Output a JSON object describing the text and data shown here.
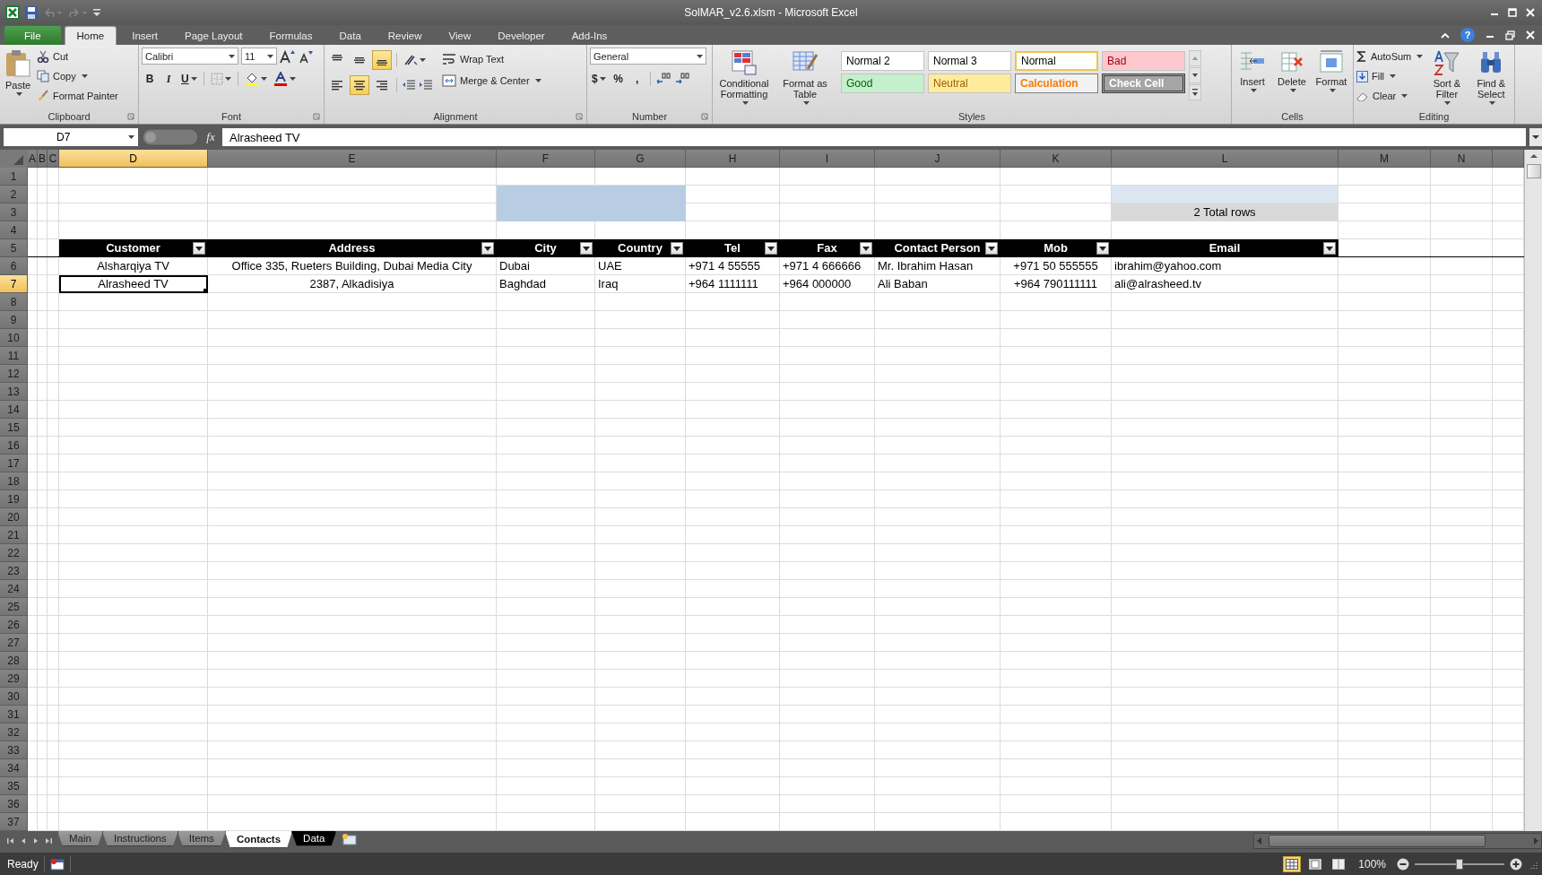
{
  "window": {
    "title": "SolMAR_v2.6.xlsm - Microsoft Excel",
    "help": "?"
  },
  "ribbon_tabs": [
    {
      "label": "File",
      "kind": "file",
      "selected": false
    },
    {
      "label": "Home",
      "kind": "tab",
      "selected": true
    },
    {
      "label": "Insert",
      "kind": "tab",
      "selected": false
    },
    {
      "label": "Page Layout",
      "kind": "tab",
      "selected": false
    },
    {
      "label": "Formulas",
      "kind": "tab",
      "selected": false
    },
    {
      "label": "Data",
      "kind": "tab",
      "selected": false
    },
    {
      "label": "Review",
      "kind": "tab",
      "selected": false
    },
    {
      "label": "View",
      "kind": "tab",
      "selected": false
    },
    {
      "label": "Developer",
      "kind": "tab",
      "selected": false
    },
    {
      "label": "Add-Ins",
      "kind": "tab",
      "selected": false
    }
  ],
  "clipboard": {
    "label": "Clipboard",
    "paste": "Paste",
    "cut": "Cut",
    "copy": "Copy",
    "format_painter": "Format Painter"
  },
  "font": {
    "label": "Font",
    "name": "Calibri",
    "size": "11",
    "bold": "B",
    "italic": "I",
    "underline": "U"
  },
  "alignment": {
    "label": "Alignment",
    "vertical": [
      {
        "selected": false
      },
      {
        "selected": false
      },
      {
        "selected": true
      }
    ],
    "horizontal": [
      {
        "selected": false
      },
      {
        "selected": true
      },
      {
        "selected": false
      }
    ],
    "wrap_text": "Wrap Text",
    "merge_center": "Merge & Center"
  },
  "number": {
    "label": "Number",
    "format": "General",
    "currency": "$",
    "percent": "%",
    "comma": ","
  },
  "styles": {
    "label": "Styles",
    "conditional_formatting": "Conditional Formatting",
    "format_as_table": "Format as Table",
    "cell_styles": [
      {
        "text": "Normal 2",
        "kind": "plain",
        "selected": false
      },
      {
        "text": "Normal 3",
        "kind": "plain",
        "selected": false
      },
      {
        "text": "Normal",
        "kind": "plain",
        "selected": true
      },
      {
        "text": "Bad",
        "kind": "bad",
        "selected": false
      },
      {
        "text": "Good",
        "kind": "good",
        "selected": false
      },
      {
        "text": "Neutral",
        "kind": "neutral",
        "selected": false
      },
      {
        "text": "Calculation",
        "kind": "calc",
        "selected": false
      },
      {
        "text": "Check Cell",
        "kind": "check",
        "selected": false
      }
    ]
  },
  "cells": {
    "label": "Cells",
    "buttons": [
      "Insert",
      "Delete",
      "Format"
    ]
  },
  "editing": {
    "label": "Editing",
    "autosum": "AutoSum",
    "fill": "Fill",
    "clear": "Clear",
    "sort_filter": "Sort & Filter",
    "find_select": "Find & Select"
  },
  "formula_bar": {
    "name_box": "D7",
    "function_label": "fx",
    "formula": "Alrasheed TV"
  },
  "sheet": {
    "columns": [
      {
        "label": "A",
        "selected": false
      },
      {
        "label": "B",
        "selected": false
      },
      {
        "label": "C",
        "selected": false
      },
      {
        "label": "D",
        "selected": true
      },
      {
        "label": "E",
        "selected": false
      },
      {
        "label": "F",
        "selected": false
      },
      {
        "label": "G",
        "selected": false
      },
      {
        "label": "H",
        "selected": false
      },
      {
        "label": "I",
        "selected": false
      },
      {
        "label": "J",
        "selected": false
      },
      {
        "label": "K",
        "selected": false
      },
      {
        "label": "L",
        "selected": false
      },
      {
        "label": "M",
        "selected": false
      },
      {
        "label": "N",
        "selected": false
      }
    ],
    "rows": [
      {
        "label": "1",
        "selected": false
      },
      {
        "label": "2",
        "selected": false
      },
      {
        "label": "3",
        "selected": false
      },
      {
        "label": "4",
        "selected": false
      },
      {
        "label": "5",
        "selected": false
      },
      {
        "label": "6",
        "selected": false
      },
      {
        "label": "7",
        "selected": true
      },
      {
        "label": "8",
        "selected": false
      },
      {
        "label": "9",
        "selected": false
      },
      {
        "label": "10",
        "selected": false
      },
      {
        "label": "11",
        "selected": false
      },
      {
        "label": "12",
        "selected": false
      },
      {
        "label": "13",
        "selected": false
      },
      {
        "label": "14",
        "selected": false
      },
      {
        "label": "15",
        "selected": false
      },
      {
        "label": "16",
        "selected": false
      },
      {
        "label": "17",
        "selected": false
      },
      {
        "label": "18",
        "selected": false
      },
      {
        "label": "19",
        "selected": false
      },
      {
        "label": "20",
        "selected": false
      },
      {
        "label": "21",
        "selected": false
      },
      {
        "label": "22",
        "selected": false
      },
      {
        "label": "23",
        "selected": false
      },
      {
        "label": "24",
        "selected": false
      },
      {
        "label": "25",
        "selected": false
      },
      {
        "label": "26",
        "selected": false
      },
      {
        "label": "27",
        "selected": false
      },
      {
        "label": "28",
        "selected": false
      },
      {
        "label": "29",
        "selected": false
      },
      {
        "label": "30",
        "selected": false
      },
      {
        "label": "31",
        "selected": false
      },
      {
        "label": "32",
        "selected": false
      },
      {
        "label": "33",
        "selected": false
      },
      {
        "label": "34",
        "selected": false
      },
      {
        "label": "35",
        "selected": false
      },
      {
        "label": "36",
        "selected": false
      },
      {
        "label": "37",
        "selected": false
      }
    ]
  },
  "summary": "2 Total rows",
  "table": {
    "columns": [
      "Customer",
      "Address",
      "City",
      "Country",
      "Tel",
      "Fax",
      "Contact Person",
      "Mob",
      "Email"
    ],
    "rows": [
      {
        "cells": [
          {
            "text": "Alsharqiya TV",
            "selected": false
          },
          {
            "text": "Office 335, Rueters Building, Dubai Media City",
            "selected": false
          },
          {
            "text": "Dubai",
            "selected": false
          },
          {
            "text": "UAE",
            "selected": false
          },
          {
            "text": "+971 4 55555",
            "selected": false
          },
          {
            "text": "+971 4 666666",
            "selected": false
          },
          {
            "text": "Mr. Ibrahim Hasan",
            "selected": false
          },
          {
            "text": "+971 50 555555",
            "selected": false
          },
          {
            "text": "ibrahim@yahoo.com",
            "selected": false
          }
        ]
      },
      {
        "cells": [
          {
            "text": "Alrasheed TV",
            "selected": true
          },
          {
            "text": "2387, Alkadisiya",
            "selected": false
          },
          {
            "text": "Baghdad",
            "selected": false
          },
          {
            "text": "Iraq",
            "selected": false
          },
          {
            "text": "+964 1111111",
            "selected": false
          },
          {
            "text": "+964 000000",
            "selected": false
          },
          {
            "text": "Ali Baban",
            "selected": false
          },
          {
            "text": "+964 790111111",
            "selected": false
          },
          {
            "text": "ali@alrasheed.tv",
            "selected": false
          }
        ]
      }
    ]
  },
  "sheet_tabs": [
    {
      "label": "Main",
      "selected": false
    },
    {
      "label": "Instructions",
      "selected": false
    },
    {
      "label": "Items",
      "selected": false
    },
    {
      "label": "Contacts",
      "selected": true
    },
    {
      "label": "Data",
      "selected": false,
      "color": "#000000"
    }
  ],
  "status_bar": {
    "status": "Ready",
    "view_buttons": [
      {
        "selected": true
      },
      {
        "selected": false
      },
      {
        "selected": false
      }
    ],
    "zoom": "100%",
    "zoom_slider": {
      "level": 0.5
    }
  }
}
